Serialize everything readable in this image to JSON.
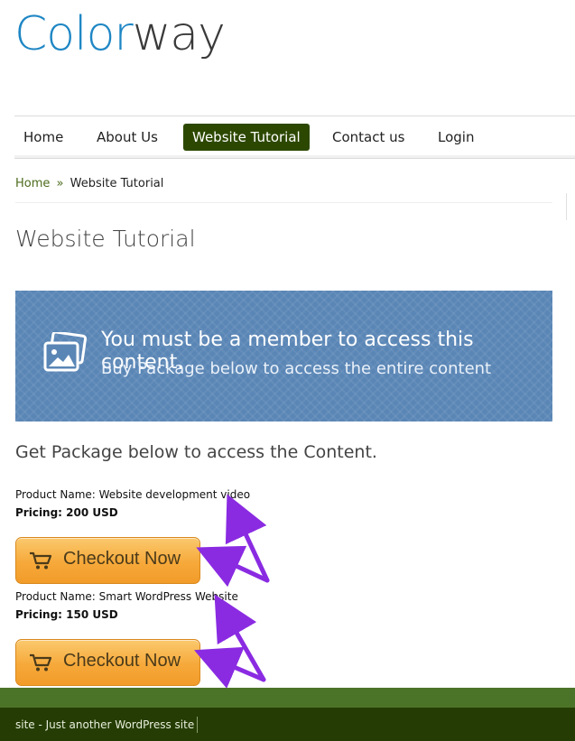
{
  "logo": {
    "part1": "Color",
    "part2": "way"
  },
  "nav": {
    "items": [
      {
        "label": "Home"
      },
      {
        "label": "About Us"
      },
      {
        "label": "Website Tutorial",
        "active": true
      },
      {
        "label": "Contact us"
      },
      {
        "label": "Login"
      }
    ]
  },
  "breadcrumb": {
    "home": "Home",
    "separator": "»",
    "current": "Website Tutorial"
  },
  "page": {
    "title": "Website Tutorial",
    "banner_line1": "You must be a member to access this content.",
    "banner_line2": "Buy Package below to access the entire content",
    "get_package": "Get Package below to access the Content."
  },
  "products": [
    {
      "name": "Product Name: Website development video",
      "pricing": "Pricing: 200 USD",
      "button": "Checkout Now"
    },
    {
      "name": "Product Name: Smart WordPress Website",
      "pricing": "Pricing: 150 USD",
      "button": "Checkout Now"
    }
  ],
  "footer": {
    "text": "site - Just another WordPress site"
  },
  "colors": {
    "brand_blue": "#1e86c4",
    "nav_active": "#2c4800",
    "banner": "#5a86b6",
    "button": "#f6a93a",
    "arrows": "#8a2be2",
    "footer": "#253d04"
  }
}
